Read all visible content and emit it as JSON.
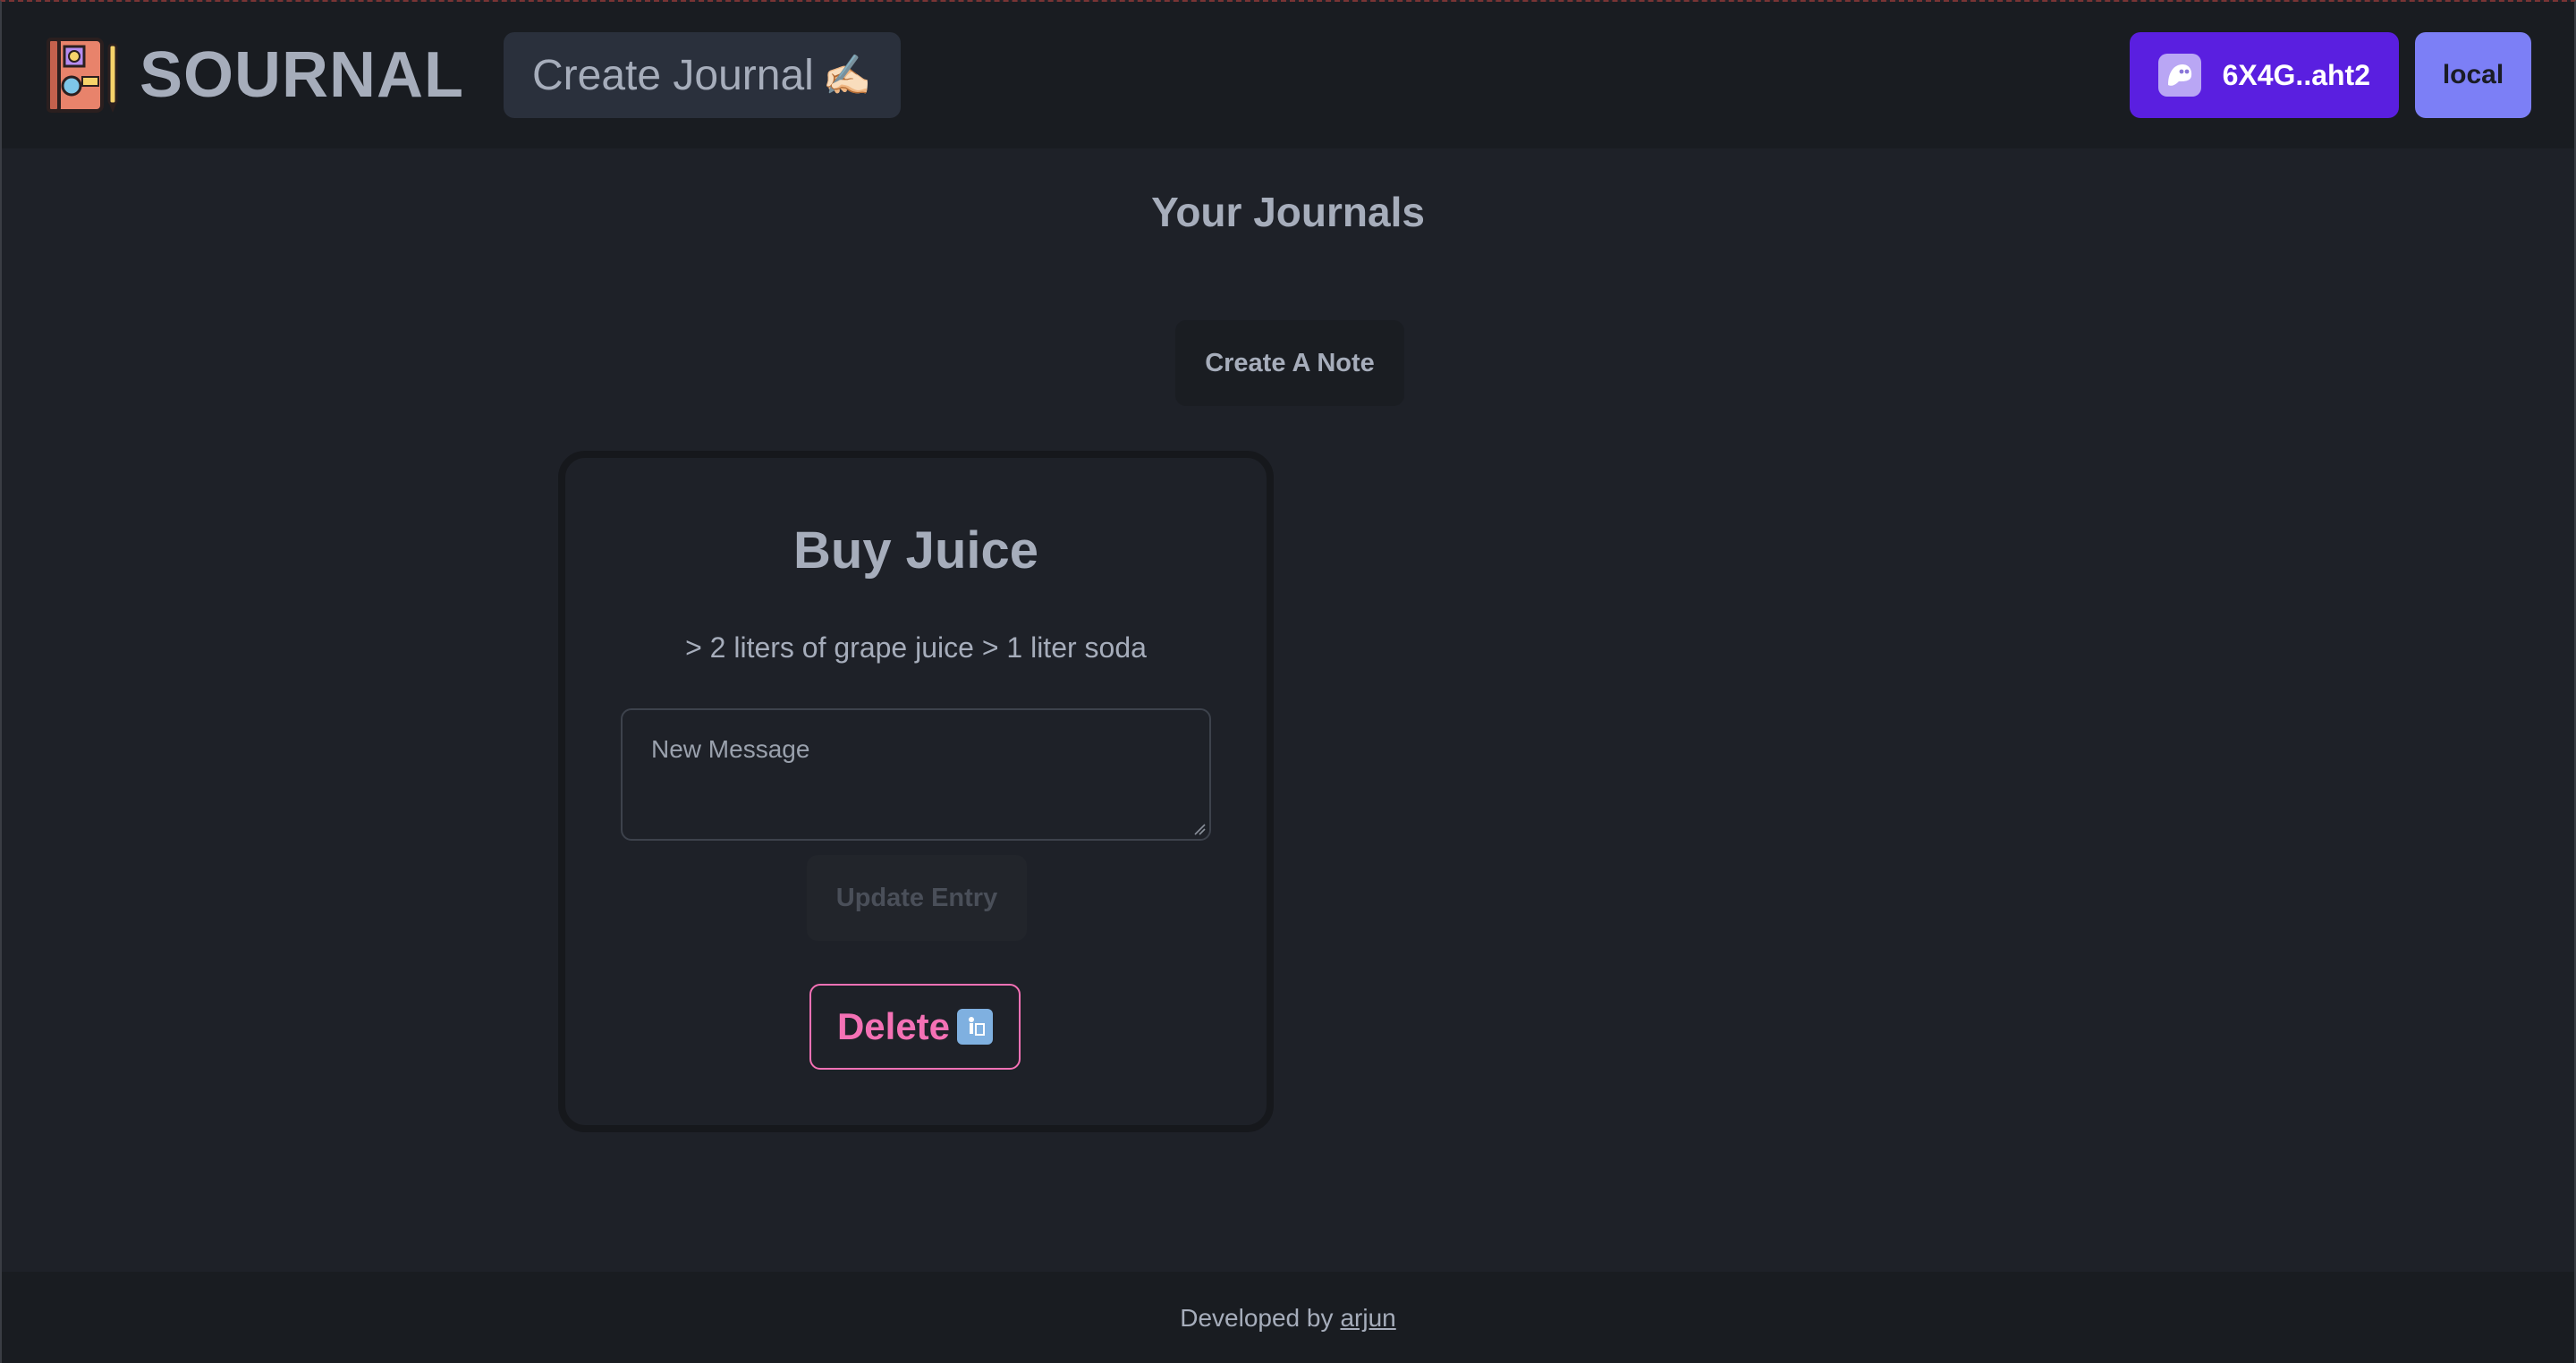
{
  "header": {
    "brand": "SOURNAL",
    "create_journal_label": "Create Journal",
    "create_journal_emoji": "✍🏻",
    "wallet_label": "6X4G..aht2",
    "network_label": "local"
  },
  "main": {
    "title": "Your Journals",
    "create_note_label": "Create A Note"
  },
  "journals": [
    {
      "title": "Buy Juice",
      "message": "> 2 liters of grape juice > 1 liter soda",
      "input_placeholder": "New Message",
      "update_label": "Update Entry",
      "delete_label": "Delete",
      "delete_emoji": "🚮"
    }
  ],
  "footer": {
    "prefix": "Developed by",
    "author": "arjun"
  },
  "colors": {
    "wallet": "#5a1fe0",
    "network": "#7c7ff6",
    "delete": "#f471b5",
    "background": "#1e2128",
    "navbar": "#191c21"
  },
  "icons": {
    "logo": "journal-logo-icon",
    "wallet": "ghost-wallet-icon",
    "trash": "trash-icon"
  }
}
